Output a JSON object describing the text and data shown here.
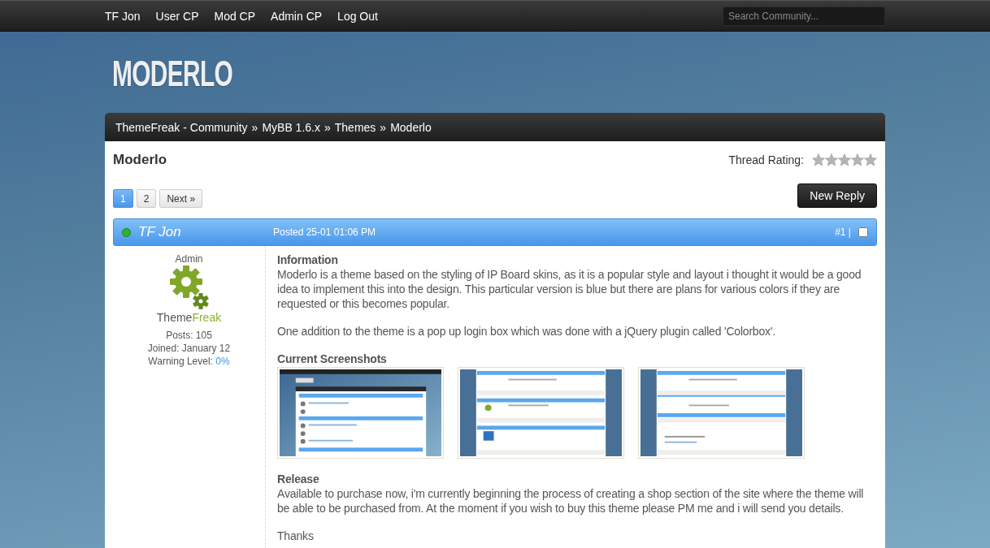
{
  "top_nav": {
    "links": [
      "TF Jon",
      "User CP",
      "Mod CP",
      "Admin CP",
      "Log Out"
    ],
    "search": {
      "placeholder": "Search Community..."
    }
  },
  "logo": "MODERLO",
  "breadcrumb": {
    "separator": "»",
    "items": [
      "ThemeFreak - Community",
      "MyBB 1.6.x",
      "Themes",
      "Moderlo"
    ]
  },
  "thread": {
    "title": "Moderlo",
    "rating_label": "Thread Rating:",
    "stars": 0,
    "pages": [
      {
        "label": "1",
        "selected": true
      },
      {
        "label": "2",
        "selected": false
      },
      {
        "label": "Next »",
        "selected": false
      }
    ],
    "new_reply": "New Reply"
  },
  "post": {
    "author": "TF Jon",
    "online": true,
    "posted": "Posted 25-01 01:06 PM",
    "number": "#1 |",
    "checked": false,
    "user": {
      "role": "Admin",
      "logo": [
        "Theme",
        "Freak"
      ],
      "stats": [
        {
          "label": "Posts:",
          "value": "105",
          "kind": "plain"
        },
        {
          "label": "Joined:",
          "value": "January 12",
          "kind": "plain"
        },
        {
          "label": "Warning Level:",
          "value": "0%",
          "kind": "link"
        }
      ]
    },
    "body": [
      {
        "kind": "heading",
        "text": "Information"
      },
      {
        "kind": "paragraph",
        "text": "Moderlo is a theme based on the styling of IP Board skins, as it is a popular style and layout i thought it would be a good idea to implement this into the design. This particular version is blue but there are plans for various colors if they are requested or this becomes popular."
      },
      {
        "kind": "gap"
      },
      {
        "kind": "paragraph",
        "text": "One addition to the theme is a pop up login box which was done with a jQuery plugin called 'Colorbox'."
      },
      {
        "kind": "gap"
      },
      {
        "kind": "heading",
        "text": "Current Screenshots"
      },
      {
        "kind": "screenshots"
      },
      {
        "kind": "gap"
      },
      {
        "kind": "heading",
        "text": "Release"
      },
      {
        "kind": "paragraph",
        "text": "Available to purchase now, i'm currently beginning the process of creating a shop section of the site where the theme will be able to be purchased from. At the moment if you wish to buy this theme please PM me and i will send you details."
      },
      {
        "kind": "gap"
      },
      {
        "kind": "paragraph",
        "text": "Thanks"
      }
    ]
  }
}
